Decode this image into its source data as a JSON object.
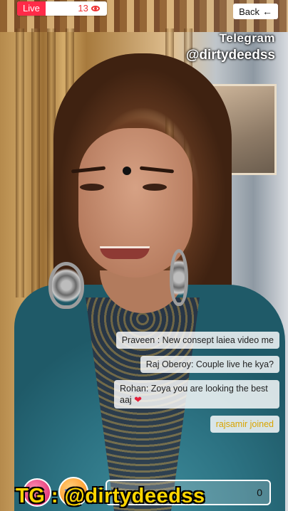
{
  "status": {
    "live_label": "Live",
    "viewer_count": "13",
    "viewer_icon": "eye-icon"
  },
  "nav": {
    "back_label": "Back",
    "back_icon": "arrow-left-icon"
  },
  "watermark": {
    "telegram": "Telegram",
    "handle": "@dirtydeedss",
    "bottom": "TG : @dirtydeedss"
  },
  "chat": {
    "messages": [
      {
        "text": "Praveen : New consept laiea video me"
      },
      {
        "text": "Raj Oberoy: Couple live he kya?"
      },
      {
        "text": "Rohan: Zoya you are looking the best aaj"
      }
    ],
    "join": "rajsamir joined"
  },
  "bottom": {
    "input_value": "0",
    "gift_icon": "gift-icon",
    "share_icon": "send-icon"
  },
  "colors": {
    "live": "#ff2b48",
    "watermark": "#ffd600",
    "join": "#d9a400"
  }
}
